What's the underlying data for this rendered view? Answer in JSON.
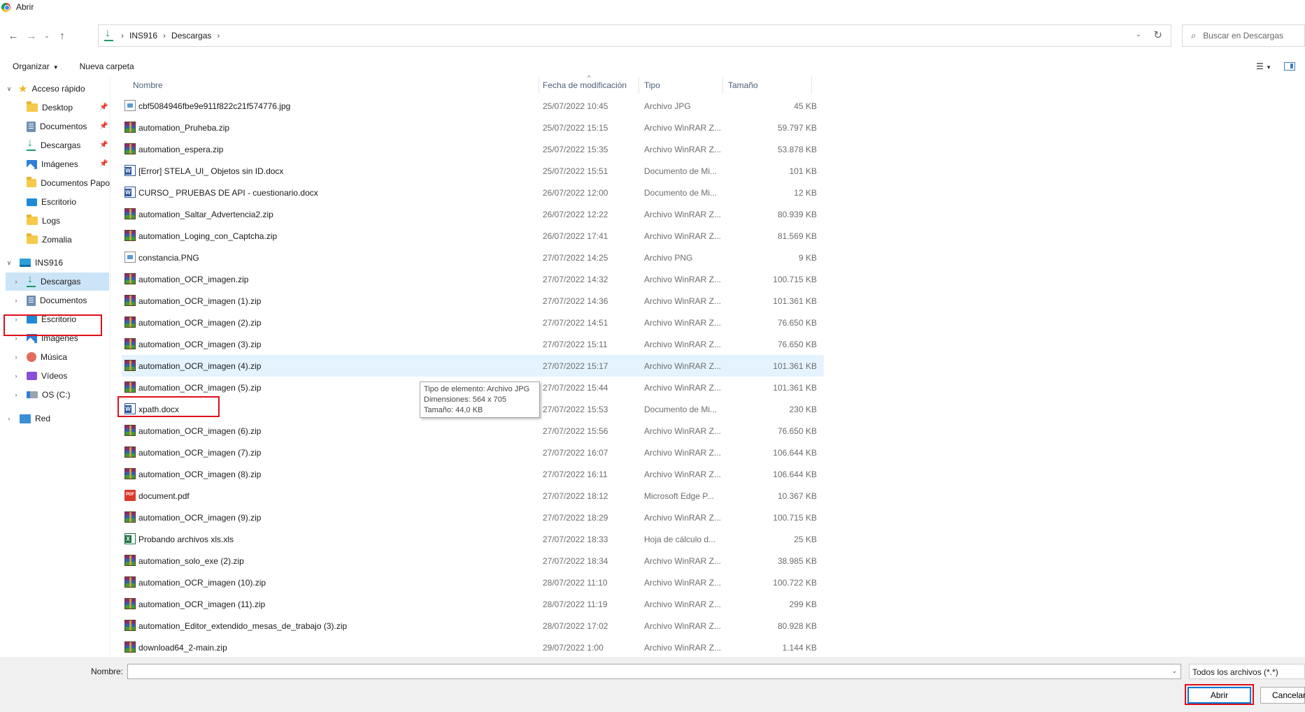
{
  "window": {
    "title": "Abrir"
  },
  "nav": {
    "breadcrumb": [
      "INS916",
      "Descargas"
    ],
    "search_placeholder": "Buscar en Descargas"
  },
  "toolbar": {
    "organize": "Organizar",
    "new_folder": "Nueva carpeta"
  },
  "sidebar": {
    "quick_access": {
      "label": "Acceso rápido",
      "items": [
        {
          "label": "Desktop",
          "icon": "folder-icon",
          "pinned": true
        },
        {
          "label": "Documentos",
          "icon": "documents-icon",
          "pinned": true
        },
        {
          "label": "Descargas",
          "icon": "download-icon",
          "pinned": true
        },
        {
          "label": "Imágenes",
          "icon": "pictures-icon",
          "pinned": true
        },
        {
          "label": "Documentos Papo",
          "icon": "folder-icon",
          "pinned": false
        },
        {
          "label": "Escritorio",
          "icon": "desktop-icon",
          "pinned": false
        },
        {
          "label": "Logs",
          "icon": "folder-icon",
          "pinned": false
        },
        {
          "label": "Zomalia",
          "icon": "folder-icon",
          "pinned": false
        }
      ]
    },
    "this_pc": {
      "label": "INS916",
      "items": [
        {
          "label": "Descargas",
          "icon": "download-icon",
          "selected": true
        },
        {
          "label": "Documentos",
          "icon": "documents-icon"
        },
        {
          "label": "Escritorio",
          "icon": "desktop-icon"
        },
        {
          "label": "Imágenes",
          "icon": "pictures-icon"
        },
        {
          "label": "Música",
          "icon": "music-icon"
        },
        {
          "label": "Vídeos",
          "icon": "videos-icon"
        },
        {
          "label": "OS (C:)",
          "icon": "disk-icon"
        }
      ]
    },
    "network": {
      "label": "Red"
    }
  },
  "columns": {
    "name": "Nombre",
    "date": "Fecha de modificación",
    "type": "Tipo",
    "size": "Tamaño"
  },
  "files": [
    {
      "name": "cbf5084946fbe9e911f822c21f574776.jpg",
      "date": "25/07/2022 10:45",
      "type": "Archivo JPG",
      "size": "45 KB",
      "kind": "jpg"
    },
    {
      "name": "automation_Pruheba.zip",
      "date": "25/07/2022 15:15",
      "type": "Archivo WinRAR Z...",
      "size": "59.797 KB",
      "kind": "zip"
    },
    {
      "name": "automation_espera.zip",
      "date": "25/07/2022 15:35",
      "type": "Archivo WinRAR Z...",
      "size": "53.878 KB",
      "kind": "zip"
    },
    {
      "name": "[Error] STELA_UI_ Objetos sin ID.docx",
      "date": "25/07/2022 15:51",
      "type": "Documento de Mi...",
      "size": "101 KB",
      "kind": "docx"
    },
    {
      "name": "CURSO_ PRUEBAS DE API - cuestionario.docx",
      "date": "26/07/2022 12:00",
      "type": "Documento de Mi...",
      "size": "12 KB",
      "kind": "docx"
    },
    {
      "name": "automation_Saltar_Advertencia2.zip",
      "date": "26/07/2022 12:22",
      "type": "Archivo WinRAR Z...",
      "size": "80.939 KB",
      "kind": "zip"
    },
    {
      "name": "automation_Loging_con_Captcha.zip",
      "date": "26/07/2022 17:41",
      "type": "Archivo WinRAR Z...",
      "size": "81.569 KB",
      "kind": "zip"
    },
    {
      "name": "constancia.PNG",
      "date": "27/07/2022 14:25",
      "type": "Archivo PNG",
      "size": "9 KB",
      "kind": "jpg"
    },
    {
      "name": "automation_OCR_imagen.zip",
      "date": "27/07/2022 14:32",
      "type": "Archivo WinRAR Z...",
      "size": "100.715 KB",
      "kind": "zip"
    },
    {
      "name": "automation_OCR_imagen (1).zip",
      "date": "27/07/2022 14:36",
      "type": "Archivo WinRAR Z...",
      "size": "101.361 KB",
      "kind": "zip"
    },
    {
      "name": "automation_OCR_imagen (2).zip",
      "date": "27/07/2022 14:51",
      "type": "Archivo WinRAR Z...",
      "size": "76.650 KB",
      "kind": "zip"
    },
    {
      "name": "automation_OCR_imagen (3).zip",
      "date": "27/07/2022 15:11",
      "type": "Archivo WinRAR Z...",
      "size": "76.650 KB",
      "kind": "zip"
    },
    {
      "name": "automation_OCR_imagen (4).zip",
      "date": "27/07/2022 15:17",
      "type": "Archivo WinRAR Z...",
      "size": "101.361 KB",
      "kind": "zip",
      "hover": true
    },
    {
      "name": "automation_OCR_imagen (5).zip",
      "date": "27/07/2022 15:44",
      "type": "Archivo WinRAR Z...",
      "size": "101.361 KB",
      "kind": "zip"
    },
    {
      "name": "xpath.docx",
      "date": "27/07/2022 15:53",
      "type": "Documento de Mi...",
      "size": "230 KB",
      "kind": "docx",
      "highlighted": true
    },
    {
      "name": "automation_OCR_imagen (6).zip",
      "date": "27/07/2022 15:56",
      "type": "Archivo WinRAR Z...",
      "size": "76.650 KB",
      "kind": "zip"
    },
    {
      "name": "automation_OCR_imagen (7).zip",
      "date": "27/07/2022 16:07",
      "type": "Archivo WinRAR Z...",
      "size": "106.644 KB",
      "kind": "zip"
    },
    {
      "name": "automation_OCR_imagen (8).zip",
      "date": "27/07/2022 16:11",
      "type": "Archivo WinRAR Z...",
      "size": "106.644 KB",
      "kind": "zip"
    },
    {
      "name": "document.pdf",
      "date": "27/07/2022 18:12",
      "type": "Microsoft Edge P...",
      "size": "10.367 KB",
      "kind": "pdf"
    },
    {
      "name": "automation_OCR_imagen (9).zip",
      "date": "27/07/2022 18:29",
      "type": "Archivo WinRAR Z...",
      "size": "100.715 KB",
      "kind": "zip"
    },
    {
      "name": "Probando archivos xls.xls",
      "date": "27/07/2022 18:33",
      "type": "Hoja de cálculo d...",
      "size": "25 KB",
      "kind": "xls"
    },
    {
      "name": "automation_solo_exe (2).zip",
      "date": "27/07/2022 18:34",
      "type": "Archivo WinRAR Z...",
      "size": "38.985 KB",
      "kind": "zip"
    },
    {
      "name": "automation_OCR_imagen (10).zip",
      "date": "28/07/2022 11:10",
      "type": "Archivo WinRAR Z...",
      "size": "100.722 KB",
      "kind": "zip"
    },
    {
      "name": "automation_OCR_imagen (11).zip",
      "date": "28/07/2022 11:19",
      "type": "Archivo WinRAR Z...",
      "size": "299 KB",
      "kind": "zip"
    },
    {
      "name": "automation_Editor_extendido_mesas_de_trabajo (3).zip",
      "date": "28/07/2022 17:02",
      "type": "Archivo WinRAR Z...",
      "size": "80.928 KB",
      "kind": "zip"
    },
    {
      "name": "download64_2-main.zip",
      "date": "29/07/2022 1:00",
      "type": "Archivo WinRAR Z...",
      "size": "1.144 KB",
      "kind": "zip"
    }
  ],
  "tooltip": {
    "lines": [
      "Tipo de elemento: Archivo JPG",
      "Dimensiones: 564 x 705",
      "Tamaño: 44,0 KB"
    ]
  },
  "footer": {
    "name_label": "Nombre:",
    "name_value": "",
    "filter": "Todos los archivos (*.*)",
    "open": "Abrir",
    "cancel": "Cancelar"
  },
  "colors": {
    "highlight_box": "#e0101a",
    "selection": "#cce4f7",
    "hover": "#e5f3ff"
  }
}
